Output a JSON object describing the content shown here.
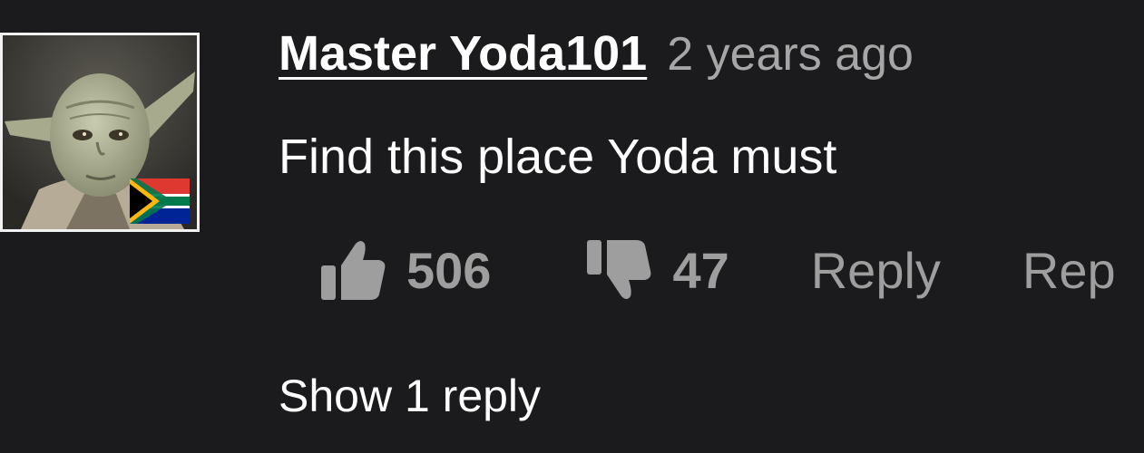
{
  "comment": {
    "author": "Master Yoda101",
    "timestamp": "2 years ago",
    "text": "Find this place Yoda must",
    "avatar_icon": "yoda-avatar-with-south-africa-flag"
  },
  "actions": {
    "like_icon": "thumbs-up-icon",
    "like_count": "506",
    "dislike_icon": "thumbs-down-icon",
    "dislike_count": "47",
    "reply_label": "Reply",
    "report_label": "Rep"
  },
  "replies": {
    "show_label": "Show 1 reply"
  },
  "colors": {
    "background": "#1b1a1c",
    "primary_text": "#ffffff",
    "secondary_text": "#a6a6a6",
    "action_gray": "#9e9e9e"
  }
}
